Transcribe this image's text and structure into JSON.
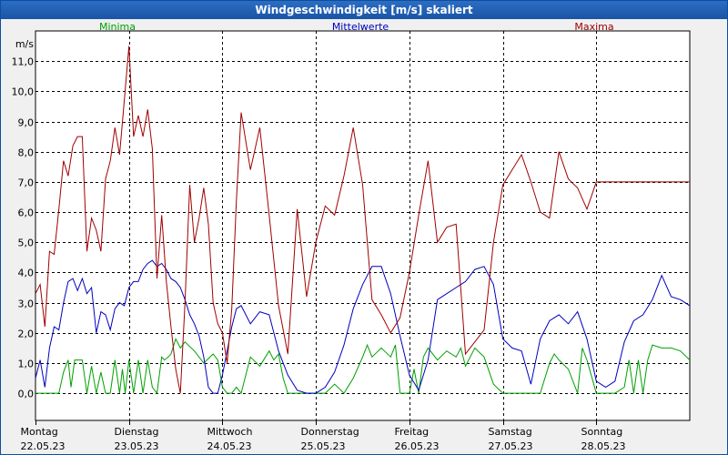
{
  "window": {
    "title": "Windgeschwindigkeit [m/s] skaliert"
  },
  "colors": {
    "minima": "#00a000",
    "mittelwerte": "#0000c0",
    "maxima": "#a00000",
    "grid": "#000000"
  },
  "chart_data": {
    "type": "line",
    "title": "Windgeschwindigkeit [m/s] skaliert",
    "ylabel": "m/s",
    "xlabel": "",
    "ylim": [
      -0.9,
      12.0
    ],
    "xlim": [
      0,
      7
    ],
    "yticks": [
      0.0,
      1.0,
      2.0,
      3.0,
      4.0,
      5.0,
      6.0,
      7.0,
      8.0,
      9.0,
      10.0,
      11.0
    ],
    "ytick_labels": [
      "0,0",
      "1,0",
      "2,0",
      "3,0",
      "4,0",
      "5,0",
      "6,0",
      "7,0",
      "8,0",
      "9,0",
      "10,0",
      "11,0"
    ],
    "xtick_labels": [
      {
        "day": "Montag",
        "date": "22.05.23"
      },
      {
        "day": "Dienstag",
        "date": "23.05.23"
      },
      {
        "day": "Mittwoch",
        "date": "24.05.23"
      },
      {
        "day": "Donnerstag",
        "date": "25.05.23"
      },
      {
        "day": "Freitag",
        "date": "26.05.23"
      },
      {
        "day": "Samstag",
        "date": "27.05.23"
      },
      {
        "day": "Sonntag",
        "date": "28.05.23"
      }
    ],
    "grid": true,
    "legend_position": "top",
    "series": [
      {
        "name": "Minima",
        "x": [
          0,
          0.25,
          0.3,
          0.35,
          0.38,
          0.42,
          0.5,
          0.55,
          0.6,
          0.65,
          0.7,
          0.75,
          0.8,
          0.85,
          0.9,
          0.93,
          0.96,
          1.0,
          1.05,
          1.1,
          1.15,
          1.2,
          1.25,
          1.3,
          1.35,
          1.38,
          1.42,
          1.45,
          1.5,
          1.55,
          1.6,
          1.7,
          1.8,
          1.9,
          1.95,
          2.0,
          2.05,
          2.1,
          2.15,
          2.2,
          2.3,
          2.4,
          2.5,
          2.55,
          2.6,
          2.65,
          2.7,
          2.8,
          2.9,
          3.0,
          3.1,
          3.2,
          3.3,
          3.4,
          3.5,
          3.55,
          3.6,
          3.7,
          3.8,
          3.85,
          3.9,
          4.0,
          4.05,
          4.1,
          4.15,
          4.2,
          4.3,
          4.4,
          4.5,
          4.55,
          4.6,
          4.7,
          4.8,
          4.9,
          5.0,
          5.1,
          5.15,
          5.2,
          5.3,
          5.4,
          5.5,
          5.55,
          5.6,
          5.7,
          5.8,
          5.85,
          5.9,
          6.0,
          6.1,
          6.2,
          6.3,
          6.35,
          6.4,
          6.45,
          6.5,
          6.55,
          6.6,
          6.7,
          6.8,
          6.9,
          7.0
        ],
        "values": [
          0.0,
          0.0,
          0.7,
          1.1,
          0.2,
          1.1,
          1.1,
          0.0,
          0.9,
          0.0,
          0.7,
          0.0,
          0.0,
          1.1,
          0.0,
          0.8,
          0.0,
          1.1,
          0.0,
          1.1,
          0.0,
          1.1,
          0.2,
          0.0,
          1.2,
          1.1,
          1.2,
          1.3,
          1.8,
          1.5,
          1.7,
          1.4,
          1.0,
          1.3,
          1.1,
          0.2,
          0.0,
          0.0,
          0.2,
          0.0,
          1.2,
          0.9,
          1.4,
          1.1,
          1.3,
          0.5,
          0.0,
          0.0,
          0.0,
          0.0,
          0.0,
          0.3,
          0.0,
          0.5,
          1.2,
          1.6,
          1.2,
          1.5,
          1.2,
          1.6,
          0.0,
          0.0,
          0.8,
          0.0,
          1.2,
          1.5,
          1.1,
          1.4,
          1.2,
          1.5,
          0.9,
          1.5,
          1.2,
          0.3,
          0.0,
          0.0,
          0.0,
          0.0,
          0.0,
          0.0,
          1.0,
          1.3,
          1.1,
          0.8,
          0.0,
          1.5,
          1.1,
          0.0,
          0.0,
          0.0,
          0.2,
          1.1,
          0.0,
          1.1,
          0.0,
          1.1,
          1.6,
          1.5,
          1.5,
          1.4,
          1.1
        ]
      },
      {
        "name": "Mittelwerte",
        "x": [
          0,
          0.05,
          0.1,
          0.15,
          0.2,
          0.25,
          0.3,
          0.35,
          0.4,
          0.45,
          0.5,
          0.55,
          0.6,
          0.65,
          0.7,
          0.75,
          0.8,
          0.85,
          0.9,
          0.95,
          1.0,
          1.05,
          1.1,
          1.15,
          1.2,
          1.25,
          1.3,
          1.35,
          1.4,
          1.45,
          1.5,
          1.55,
          1.6,
          1.65,
          1.7,
          1.75,
          1.8,
          1.85,
          1.9,
          1.95,
          2.0,
          2.05,
          2.1,
          2.15,
          2.2,
          2.3,
          2.4,
          2.5,
          2.6,
          2.7,
          2.8,
          2.9,
          3.0,
          3.1,
          3.2,
          3.3,
          3.4,
          3.5,
          3.6,
          3.7,
          3.8,
          3.9,
          4.0,
          4.1,
          4.2,
          4.3,
          4.4,
          4.5,
          4.6,
          4.7,
          4.8,
          4.9,
          5.0,
          5.1,
          5.2,
          5.3,
          5.4,
          5.5,
          5.6,
          5.7,
          5.8,
          5.9,
          6.0,
          6.1,
          6.2,
          6.3,
          6.4,
          6.5,
          6.6,
          6.7,
          6.8,
          6.9,
          7.0
        ],
        "values": [
          0.5,
          1.1,
          0.2,
          1.5,
          2.2,
          2.1,
          3.0,
          3.7,
          3.8,
          3.4,
          3.8,
          3.3,
          3.5,
          2.0,
          2.7,
          2.6,
          2.1,
          2.8,
          3.0,
          2.9,
          3.5,
          3.7,
          3.7,
          4.1,
          4.3,
          4.4,
          4.2,
          4.3,
          4.1,
          3.8,
          3.7,
          3.5,
          3.1,
          2.6,
          2.3,
          1.9,
          1.2,
          0.2,
          0.0,
          0.0,
          0.6,
          1.4,
          2.2,
          2.8,
          2.9,
          2.3,
          2.7,
          2.6,
          1.4,
          0.6,
          0.1,
          0.0,
          0.0,
          0.2,
          0.7,
          1.6,
          2.8,
          3.6,
          4.2,
          4.2,
          3.3,
          1.9,
          0.6,
          0.1,
          1.1,
          3.1,
          3.3,
          3.5,
          3.7,
          4.1,
          4.2,
          3.6,
          1.8,
          1.5,
          1.4,
          0.3,
          1.8,
          2.4,
          2.6,
          2.3,
          2.7,
          1.8,
          0.4,
          0.2,
          0.4,
          1.7,
          2.4,
          2.6,
          3.1,
          3.9,
          3.2,
          3.1,
          2.9
        ]
      },
      {
        "name": "Maxima",
        "x": [
          0,
          0.05,
          0.1,
          0.15,
          0.2,
          0.25,
          0.3,
          0.35,
          0.4,
          0.45,
          0.5,
          0.55,
          0.6,
          0.65,
          0.7,
          0.75,
          0.8,
          0.85,
          0.9,
          0.95,
          1.0,
          1.05,
          1.1,
          1.15,
          1.2,
          1.25,
          1.3,
          1.35,
          1.4,
          1.45,
          1.5,
          1.55,
          1.6,
          1.65,
          1.7,
          1.75,
          1.8,
          1.85,
          1.9,
          1.95,
          2.0,
          2.05,
          2.1,
          2.15,
          2.2,
          2.3,
          2.4,
          2.5,
          2.6,
          2.7,
          2.8,
          2.9,
          3.0,
          3.1,
          3.2,
          3.3,
          3.4,
          3.5,
          3.6,
          3.7,
          3.8,
          3.9,
          4.0,
          4.1,
          4.2,
          4.3,
          4.4,
          4.5,
          4.6,
          4.7,
          4.8,
          4.9,
          5.0,
          5.1,
          5.2,
          5.3,
          5.4,
          5.5,
          5.6,
          5.7,
          5.8,
          5.9,
          6.0,
          6.1,
          6.2,
          6.3,
          6.4,
          6.5,
          6.6,
          6.7,
          6.8,
          6.9,
          7.0
        ],
        "values": [
          3.3,
          3.6,
          2.2,
          4.7,
          4.6,
          6.1,
          7.7,
          7.2,
          8.2,
          8.5,
          8.5,
          4.7,
          5.8,
          5.4,
          4.7,
          7.1,
          7.7,
          8.8,
          7.9,
          9.7,
          11.5,
          8.5,
          9.2,
          8.5,
          9.4,
          8.1,
          3.8,
          5.9,
          3.7,
          2.2,
          0.8,
          0.0,
          3.0,
          6.9,
          5.0,
          5.8,
          6.8,
          5.6,
          3.0,
          2.3,
          2.0,
          1.0,
          2.8,
          6.4,
          9.3,
          7.4,
          8.8,
          5.9,
          2.9,
          1.3,
          6.1,
          3.2,
          5.0,
          6.2,
          5.9,
          7.2,
          8.8,
          6.9,
          3.1,
          2.6,
          2.0,
          2.5,
          4.0,
          5.9,
          7.7,
          5.0,
          5.5,
          5.6,
          1.3,
          1.7,
          2.1,
          5.0,
          6.9,
          7.4,
          7.9,
          7.0,
          6.0,
          5.8,
          8.0,
          7.1,
          6.8,
          6.1,
          7.0,
          7.0,
          7.0,
          7.0,
          7.0,
          7.0,
          7.0,
          7.0,
          7.0,
          7.0,
          7.0
        ]
      }
    ]
  }
}
